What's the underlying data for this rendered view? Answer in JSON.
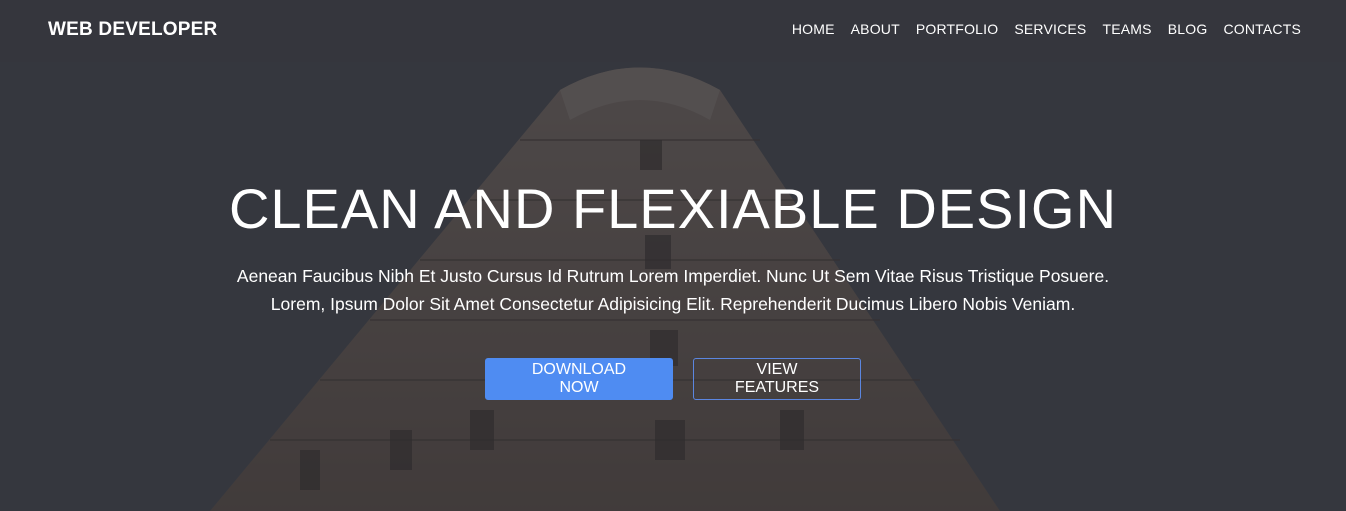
{
  "navbar": {
    "brand": "WEB DEVELOPER",
    "items": [
      {
        "label": "HOME"
      },
      {
        "label": "ABOUT"
      },
      {
        "label": "PORTFOLIO"
      },
      {
        "label": "SERVICES"
      },
      {
        "label": "TEAMS"
      },
      {
        "label": "BLOG"
      },
      {
        "label": "CONTACTS"
      }
    ]
  },
  "hero": {
    "title": "CLEAN AND FLEXIABLE DESIGN",
    "subtitle_line1": "Aenean Faucibus Nibh Et Justo Cursus Id Rutrum Lorem Imperdiet. Nunc Ut Sem Vitae Risus Tristique Posuere.",
    "subtitle_line2": "Lorem, Ipsum Dolor Sit Amet Consectetur Adipisicing Elit. Reprehenderit Ducimus Libero Nobis Veniam.",
    "primary_button": "DOWNLOAD NOW",
    "secondary_button": "VIEW FEATURES"
  },
  "colors": {
    "accent": "#4f8cf2",
    "overlay": "#2f3137"
  }
}
